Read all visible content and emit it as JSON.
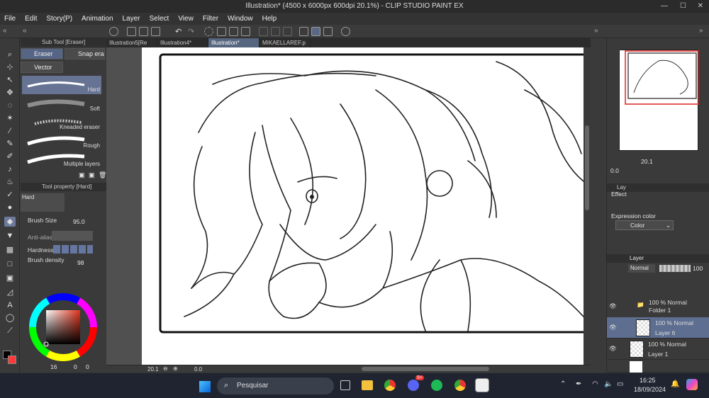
{
  "window": {
    "title": "Illustration* (4500 x 6000px 600dpi 20.1%) - CLIP STUDIO PAINT EX"
  },
  "menu": [
    "File",
    "Edit",
    "Story(P)",
    "Animation",
    "Layer",
    "Select",
    "View",
    "Filter",
    "Window",
    "Help"
  ],
  "doc_tabs": [
    {
      "label": "Illustration5[Re"
    },
    {
      "label": "Illustration4*"
    },
    {
      "label": "Illustration*",
      "active": true
    },
    {
      "label": "MIKAELLAREF.p"
    }
  ],
  "subtool": {
    "header": "Sub Tool [Eraser]",
    "tabs": [
      {
        "label": "Eraser",
        "active": true
      },
      {
        "label": "Snap erase"
      },
      {
        "label": "Vector"
      }
    ],
    "brushes": [
      {
        "label": "Hard",
        "active": true
      },
      {
        "label": "Soft"
      },
      {
        "label": "Kneaded eraser"
      },
      {
        "label": "Rough"
      },
      {
        "label": "Multiple layers"
      }
    ]
  },
  "toolprop": {
    "header": "Tool property [Hard]",
    "preset": "Hard",
    "brush_size_label": "Brush Size",
    "brush_size_value": "95.0",
    "antialias_label": "Anti-alias",
    "hardness_label": "Hardness",
    "density_label": "Brush density",
    "density_value": "98"
  },
  "color": {
    "nums": [
      "16",
      "0",
      "0"
    ],
    "main": "#000000",
    "sub": "#ff3a3a",
    "picker_hue": "#e0341c"
  },
  "canvas_status": {
    "zoom": "20.1",
    "rotation": "0.0"
  },
  "navigator": {
    "zoom": "20.1",
    "rotation": "0.0"
  },
  "property": {
    "effect_label": "Effect",
    "expression_label": "Expression color",
    "color_value": "Color"
  },
  "layer_panel": {
    "header": "Layer",
    "blend": "Normal",
    "opacity": "100",
    "layers": [
      {
        "mode": "100 % Normal",
        "name": "Folder 1",
        "type": "folder"
      },
      {
        "mode": "100 % Normal",
        "name": "Layer 6",
        "active": true
      },
      {
        "mode": "100 % Normal",
        "name": "Layer 1"
      }
    ]
  },
  "taskbar": {
    "search_placeholder": "Pesquisar",
    "time": "16:25",
    "date": "18/09/2024",
    "badge": "9+"
  }
}
